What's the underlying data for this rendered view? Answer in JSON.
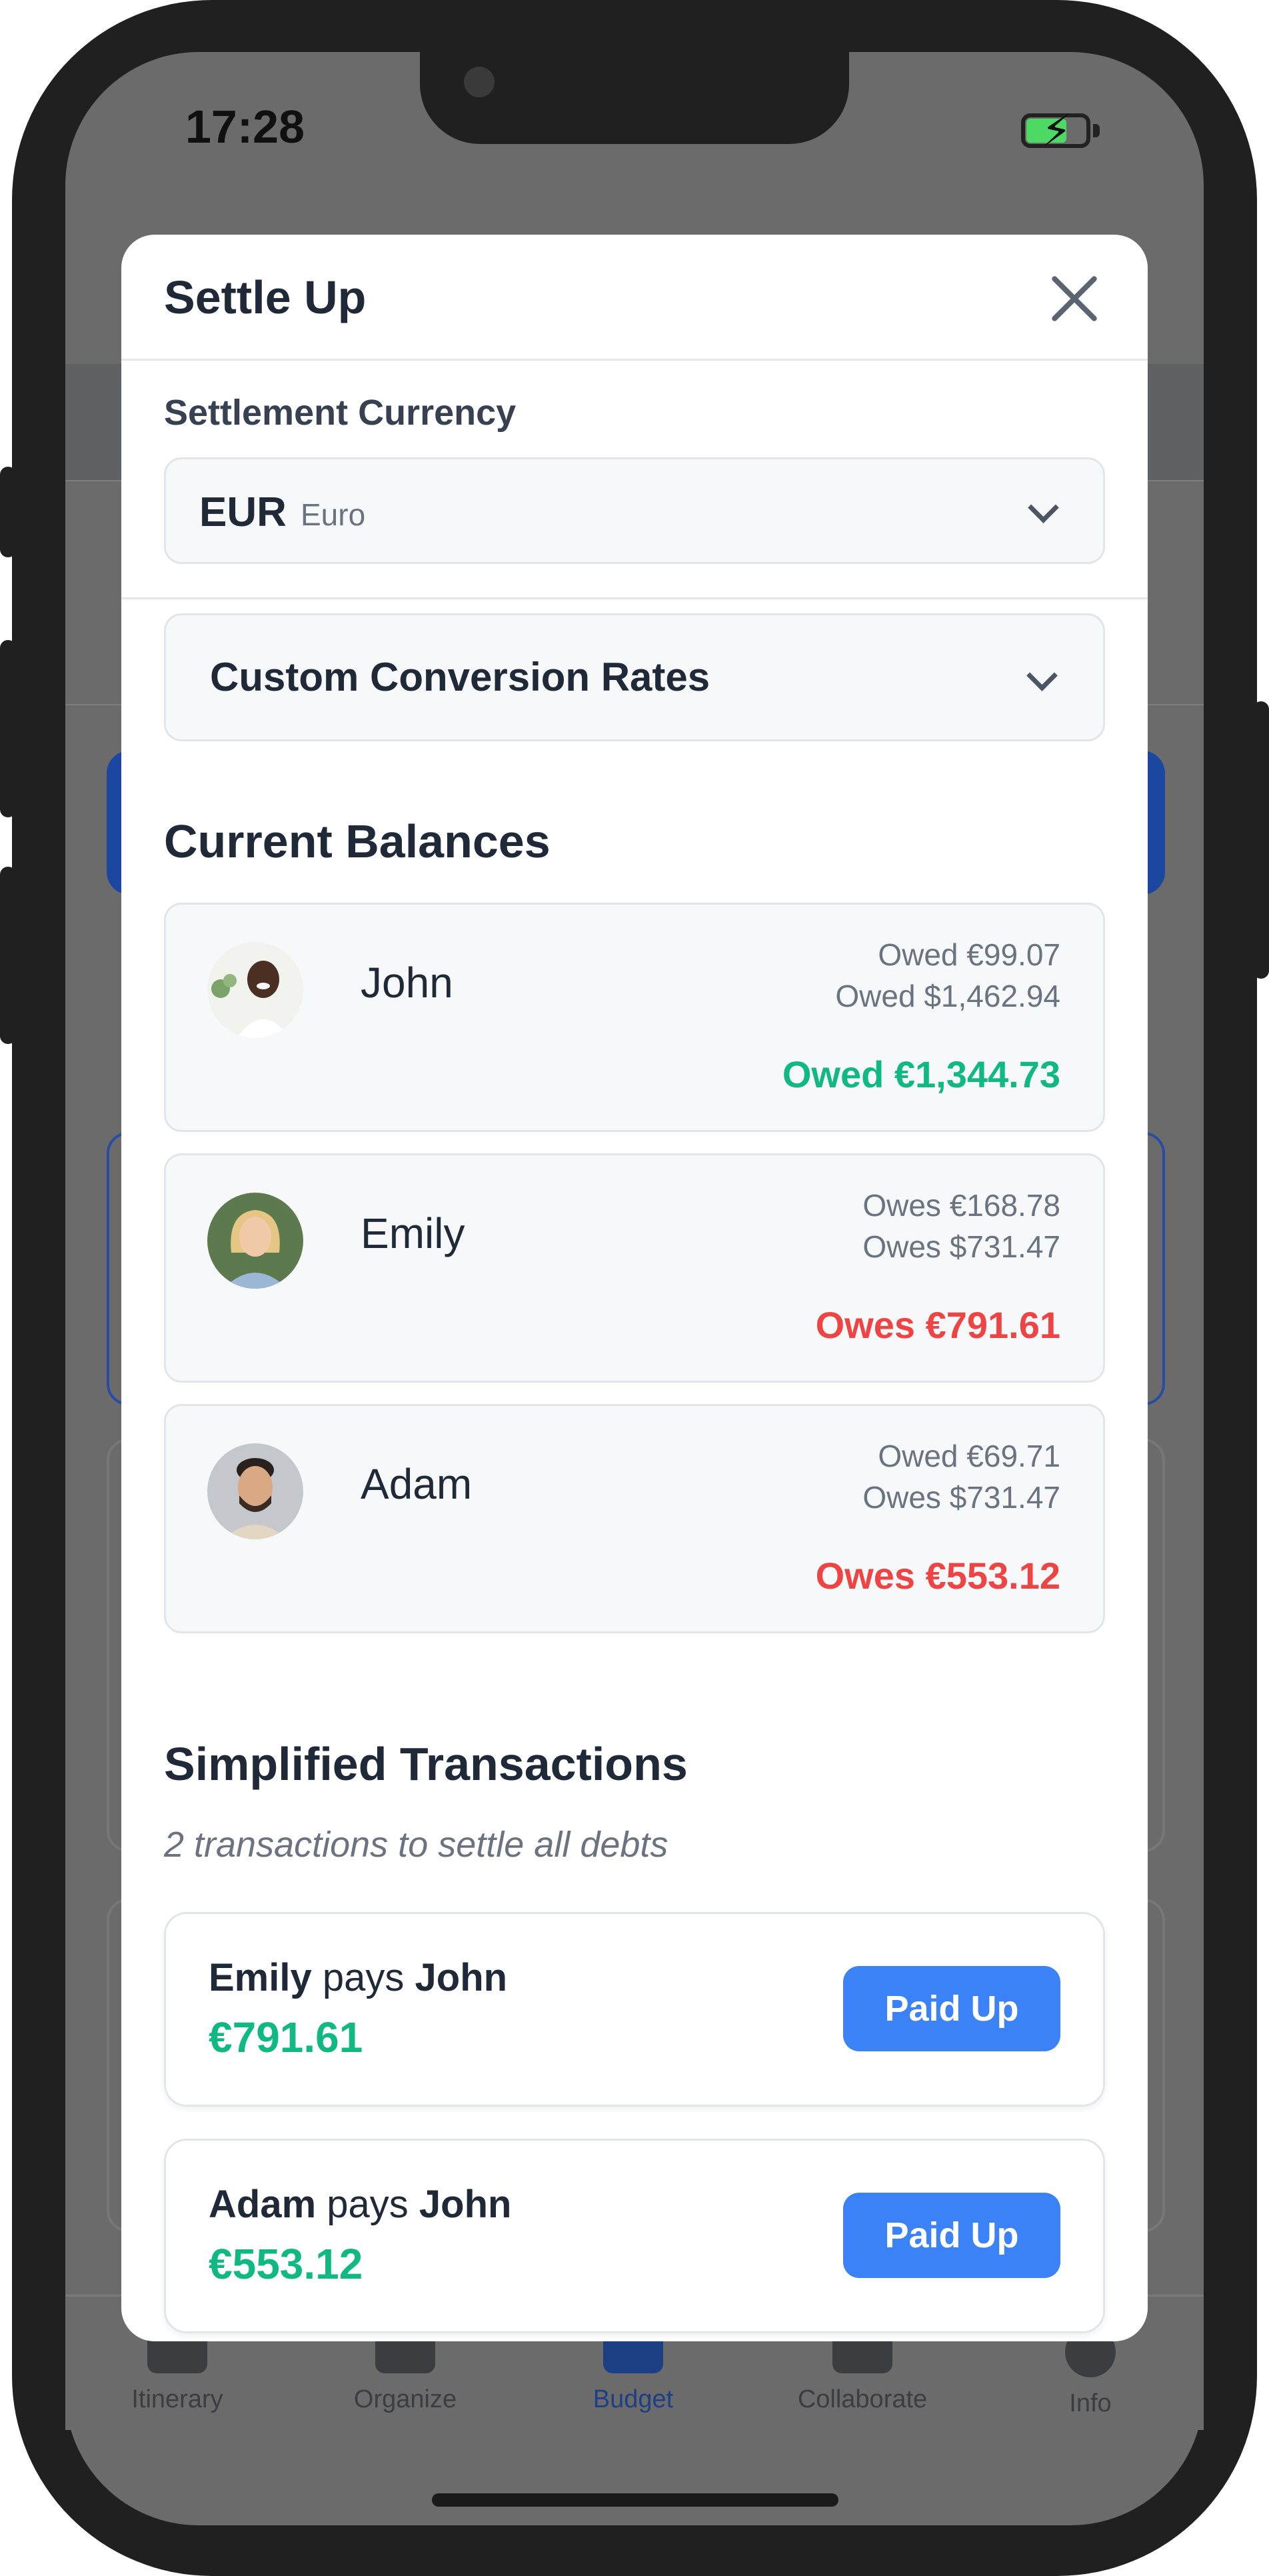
{
  "status_bar": {
    "time": "17:28"
  },
  "modal": {
    "title": "Settle Up",
    "settlement_currency_label": "Settlement Currency",
    "currency": {
      "code": "EUR",
      "name": "Euro"
    },
    "custom_rates_label": "Custom Conversion Rates",
    "balances_title": "Current Balances",
    "balances": [
      {
        "name": "John",
        "line1": "Owed €99.07",
        "line2": "Owed $1,462.94",
        "total": "Owed €1,344.73",
        "status": "owed"
      },
      {
        "name": "Emily",
        "line1": "Owes €168.78",
        "line2": "Owes $731.47",
        "total": "Owes €791.61",
        "status": "owes"
      },
      {
        "name": "Adam",
        "line1": "Owed €69.71",
        "line2": "Owes $731.47",
        "total": "Owes €553.12",
        "status": "owes"
      }
    ],
    "transactions_title": "Simplified Transactions",
    "transactions_subtitle": "2 transactions to settle all debts",
    "transactions": [
      {
        "from": "Emily",
        "verb": "pays",
        "to": "John",
        "amount": "€791.61",
        "button": "Paid Up"
      },
      {
        "from": "Adam",
        "verb": "pays",
        "to": "John",
        "amount": "€553.12",
        "button": "Paid Up"
      }
    ]
  },
  "tab_bar": {
    "tabs": [
      {
        "label": "Itinerary",
        "icon": "calendar-icon"
      },
      {
        "label": "Organize",
        "icon": "folder-icon"
      },
      {
        "label": "Budget",
        "icon": "money-icon",
        "active": true
      },
      {
        "label": "Collaborate",
        "icon": "people-icon"
      },
      {
        "label": "Info",
        "icon": "info-icon"
      }
    ]
  },
  "colors": {
    "accent": "#3b82f6",
    "positive": "#10b981",
    "negative": "#ef4444"
  }
}
